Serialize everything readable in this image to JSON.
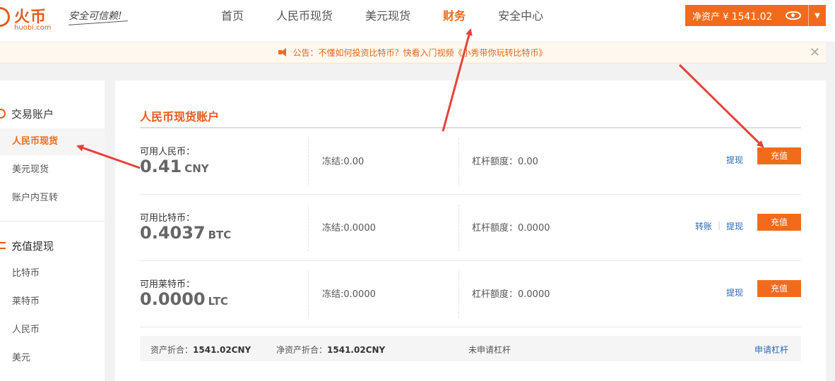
{
  "header": {
    "logo_text": "火币",
    "logo_domain": "huobi.com",
    "slogan": "安全可信赖!",
    "nav": [
      {
        "label": "首页",
        "active": false
      },
      {
        "label": "人民币现货",
        "active": false
      },
      {
        "label": "美元现货",
        "active": false
      },
      {
        "label": "财务",
        "active": true
      },
      {
        "label": "安全中心",
        "active": false
      }
    ],
    "net_asset_label": "净资产 ¥",
    "net_asset_value": "1541.02"
  },
  "notice": {
    "text": "公告：不懂如何投资比特币？快看入门视频《小秀带你玩转比特币》",
    "close": "✕"
  },
  "sidebar": {
    "sections": [
      {
        "title": "交易账户",
        "items": [
          "人民币现货",
          "美元现货",
          "账户内互转"
        ]
      },
      {
        "title": "充值提现",
        "items": [
          "比特币",
          "莱特币",
          "人民币",
          "美元"
        ]
      }
    ],
    "active_item": "人民币现货"
  },
  "main": {
    "title": "人民币现货账户",
    "rows": [
      {
        "label": "可用人民币：",
        "amount": "0.41",
        "unit": "CNY",
        "frozen": "冻结:0.00",
        "lever": "杠杆额度：0.00",
        "transfer": "",
        "withdraw": "提现",
        "deposit": "充值"
      },
      {
        "label": "可用比特币：",
        "amount": "0.4037",
        "unit": "BTC",
        "frozen": "冻结:0.0000",
        "lever": "杠杆额度：0.0000",
        "transfer": "转账",
        "withdraw": "提现",
        "deposit": "充值"
      },
      {
        "label": "可用莱特币：",
        "amount": "0.0000",
        "unit": "LTC",
        "frozen": "冻结:0.0000",
        "lever": "杠杆额度：0.0000",
        "transfer": "",
        "withdraw": "提现",
        "deposit": "充值"
      }
    ],
    "link_separator": "|",
    "summary": {
      "assets_label": "资产折合：",
      "assets_value": "1541.02CNY",
      "net_label": "净资产折合：",
      "net_value": "1541.02CNY",
      "leverage_status": "未申请杠杆",
      "apply_leverage": "申请杠杆"
    }
  },
  "colors": {
    "accent": "#f26b1d",
    "link": "#2a6bb2",
    "annotation_arrow": "#e8413a"
  }
}
